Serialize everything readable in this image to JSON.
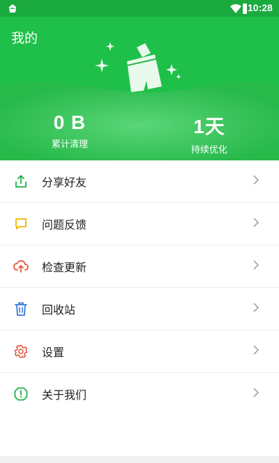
{
  "status_bar": {
    "time": "10:28",
    "icons": [
      "app-notification-icon",
      "wifi-icon",
      "battery-icon"
    ]
  },
  "header": {
    "title": "我的",
    "colors": {
      "primary": "#1fc04a",
      "dark": "#1aaa3e"
    },
    "illustration_icon": "broom-icon",
    "stats": [
      {
        "value": "0 B",
        "label": "累计清理"
      },
      {
        "value": "1天",
        "label": "持续优化"
      }
    ]
  },
  "menu": {
    "items": [
      {
        "label": "分享好友",
        "icon": "share-icon",
        "color": "#1fb04a"
      },
      {
        "label": "问题反馈",
        "icon": "feedback-icon",
        "color": "#f0b400"
      },
      {
        "label": "检查更新",
        "icon": "cloud-upload-icon",
        "color": "#e8553a"
      },
      {
        "label": "回收站",
        "icon": "trash-icon",
        "color": "#3a78d8"
      },
      {
        "label": "设置",
        "icon": "gear-icon",
        "color": "#e8553a"
      },
      {
        "label": "关于我们",
        "icon": "info-icon",
        "color": "#1fb04a"
      }
    ]
  }
}
